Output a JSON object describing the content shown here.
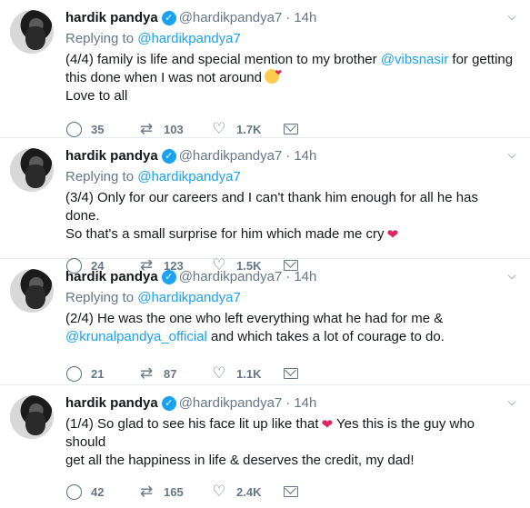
{
  "tweets": [
    {
      "name": "hardik pandya",
      "handle": "@hardikpandya7",
      "dot": "·",
      "time": "14h",
      "replying_prefix": "Replying to",
      "replying_handle": "@hardikpandya7",
      "text_lines": [
        {
          "pre": "(4/4) family is life and special mention to my brother ",
          "link": "@vibsnasir",
          "post": " for getting this done when I was not around",
          "emoji": "kiss-heart-emoji"
        },
        {
          "pre": "Love to all",
          "link": "",
          "post": "",
          "emoji": ""
        }
      ],
      "replies": "35",
      "retweets": "103",
      "likes": "1.7K"
    },
    {
      "name": "hardik pandya",
      "handle": "@hardikpandya7",
      "dot": "·",
      "time": "14h",
      "replying_prefix": "Replying to",
      "replying_handle": "@hardikpandya7",
      "text_lines": [
        {
          "pre": "(3/4) Only for our careers and I can't thank him enough for all he has done.",
          "link": "",
          "post": "",
          "emoji": ""
        },
        {
          "pre": "So that's a small surprise for him which made me cry",
          "link": "",
          "post": "",
          "emoji": "red-heart-emoji"
        }
      ],
      "replies": "24",
      "retweets": "123",
      "likes": "1.5K"
    },
    {
      "name": "hardik pandya",
      "handle": "@hardikpandya7",
      "dot": "·",
      "time": "14h",
      "replying_prefix": "Replying to",
      "replying_handle": "@hardikpandya7",
      "text_lines": [
        {
          "pre": "(2/4) He was the one who left everything what he had for me &",
          "link": "",
          "post": "",
          "emoji": ""
        },
        {
          "pre": "",
          "link": "@krunalpandya_official",
          "post": " and which takes a lot of courage to do.",
          "emoji": ""
        }
      ],
      "replies": "21",
      "retweets": "87",
      "likes": "1.1K"
    },
    {
      "name": "hardik pandya",
      "handle": "@hardikpandya7",
      "dot": "·",
      "time": "14h",
      "replying_prefix": "",
      "replying_handle": "",
      "text_lines": [
        {
          "pre": "(1/4) So glad to see his face lit up like that",
          "link": "",
          "post": " Yes this is the guy who should",
          "emoji": "red-heart-emoji"
        },
        {
          "pre": "get all the happiness in life & deserves the credit, my dad!",
          "link": "",
          "post": "",
          "emoji": ""
        }
      ],
      "replies": "42",
      "retweets": "165",
      "likes": "2.4K"
    }
  ],
  "icons": {
    "verified": "verified-badge-icon",
    "caret": "chevron-down-icon",
    "reply": "reply-icon",
    "retweet": "retweet-icon",
    "like": "heart-icon",
    "dm": "envelope-icon"
  },
  "colors": {
    "accent": "#1da1f2",
    "muted": "#657786",
    "text": "#14171a",
    "heart": "#e0245e",
    "border": "#e6ecf0"
  }
}
